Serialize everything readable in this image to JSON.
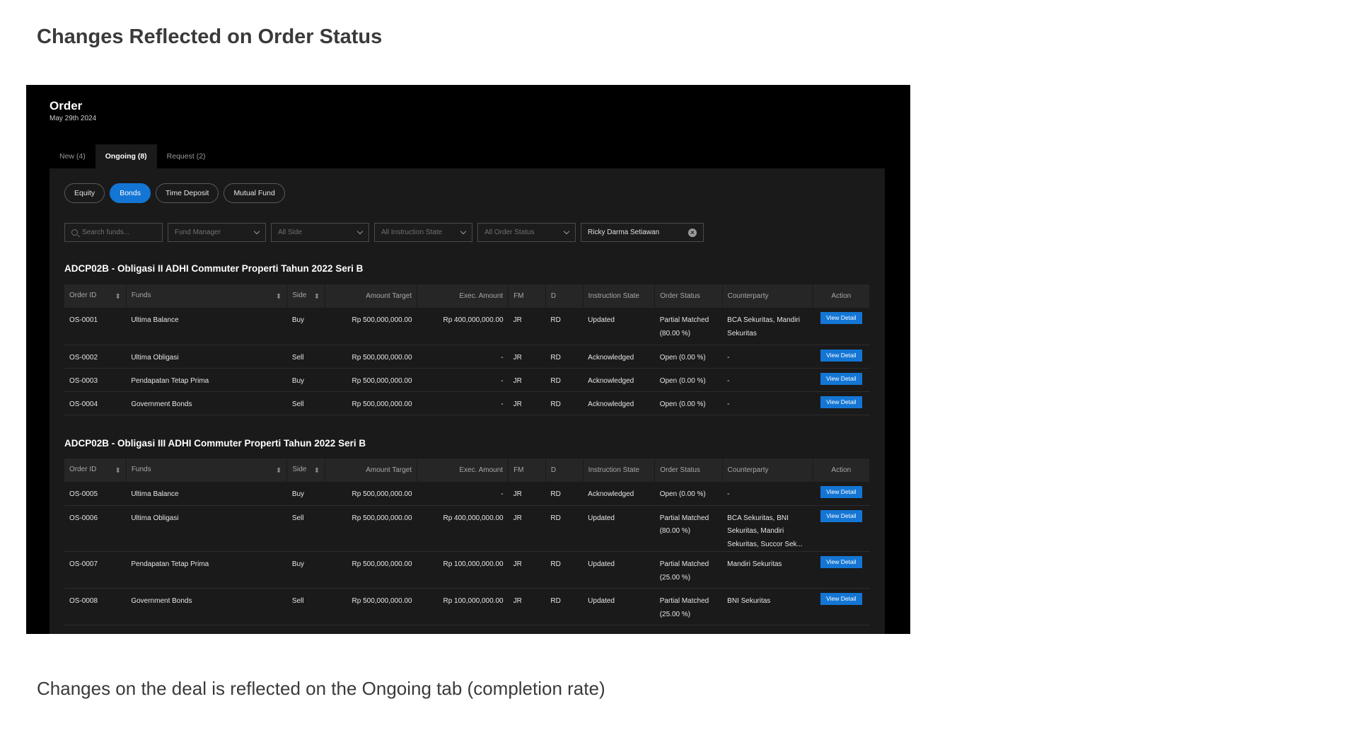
{
  "page": {
    "heading": "Changes Reflected on Order Status",
    "caption": "Changes on the deal is reflected on the Ongoing tab (completion rate)"
  },
  "app": {
    "title": "Order",
    "date": "May 29th 2024",
    "tabs": [
      "New (4)",
      "Ongoing (8)",
      "Request (2)"
    ],
    "asset_pills": [
      "Equity",
      "Bonds",
      "Time Deposit",
      "Mutual Fund"
    ],
    "filters": {
      "search_placeholder": "Search funds...",
      "fund_manager": "Fund Manager",
      "side": "All Side",
      "instruction_state": "All Instruction State",
      "order_status": "All Order Status",
      "person": "Ricky Darma Setiawan"
    },
    "columns": [
      "Order ID",
      "Funds",
      "Side",
      "Amount Target",
      "Exec. Amount",
      "FM",
      "D",
      "Instruction State",
      "Order Status",
      "Counterparty",
      "Action"
    ],
    "action_label": "View Detail",
    "sections": [
      {
        "title": "ADCP02B - Obligasi II ADHI Commuter Properti Tahun 2022 Seri B",
        "rows": [
          {
            "id": "OS-0001",
            "fund": "Ultima Balance",
            "side": "Buy",
            "target": "Rp 500,000,000.00",
            "exec": "Rp 400,000,000.00",
            "fm": "JR",
            "d": "RD",
            "instruction": "Updated",
            "status": "Partial Matched (80.00 %)",
            "counterparty": "BCA Sekuritas, Mandiri Sekuritas"
          },
          {
            "id": "OS-0002",
            "fund": "Ultima Obligasi",
            "side": "Sell",
            "target": "Rp 500,000,000.00",
            "exec": "-",
            "fm": "JR",
            "d": "RD",
            "instruction": "Acknowledged",
            "status": "Open (0.00 %)",
            "counterparty": "-"
          },
          {
            "id": "OS-0003",
            "fund": "Pendapatan Tetap Prima",
            "side": "Buy",
            "target": "Rp 500,000,000.00",
            "exec": "-",
            "fm": "JR",
            "d": "RD",
            "instruction": "Acknowledged",
            "status": "Open (0.00 %)",
            "counterparty": "-"
          },
          {
            "id": "OS-0004",
            "fund": "Government Bonds",
            "side": "Sell",
            "target": "Rp 500,000,000.00",
            "exec": "-",
            "fm": "JR",
            "d": "RD",
            "instruction": "Acknowledged",
            "status": "Open (0.00 %)",
            "counterparty": "-"
          }
        ]
      },
      {
        "title": "ADCP02B - Obligasi III ADHI Commuter Properti Tahun 2022 Seri B",
        "rows": [
          {
            "id": "OS-0005",
            "fund": "Ultima Balance",
            "side": "Buy",
            "target": "Rp 500,000,000.00",
            "exec": "-",
            "fm": "JR",
            "d": "RD",
            "instruction": "Acknowledged",
            "status": "Open (0.00 %)",
            "counterparty": "-"
          },
          {
            "id": "OS-0006",
            "fund": "Ultima Obligasi",
            "side": "Sell",
            "target": "Rp 500,000,000.00",
            "exec": "Rp 400,000,000.00",
            "fm": "JR",
            "d": "RD",
            "instruction": "Updated",
            "status": "Partial Matched (80.00 %)",
            "counterparty": "BCA Sekuritas, BNI Sekuritas, Mandiri Sekuritas, Succor Sek..."
          },
          {
            "id": "OS-0007",
            "fund": "Pendapatan Tetap Prima",
            "side": "Buy",
            "target": "Rp 500,000,000.00",
            "exec": "Rp 100,000,000.00",
            "fm": "JR",
            "d": "RD",
            "instruction": "Updated",
            "status": "Partial Matched (25.00 %)",
            "counterparty": "Mandiri Sekuritas"
          },
          {
            "id": "OS-0008",
            "fund": "Government Bonds",
            "side": "Sell",
            "target": "Rp 500,000,000.00",
            "exec": "Rp 100,000,000.00",
            "fm": "JR",
            "d": "RD",
            "instruction": "Updated",
            "status": "Partial Matched (25.00 %)",
            "counterparty": "BNI Sekuritas"
          }
        ]
      }
    ]
  },
  "colors": {
    "accent": "#1476d4",
    "buy": "#3aa65a",
    "sell": "#d83a3a",
    "panel": "#1a1a1a"
  }
}
